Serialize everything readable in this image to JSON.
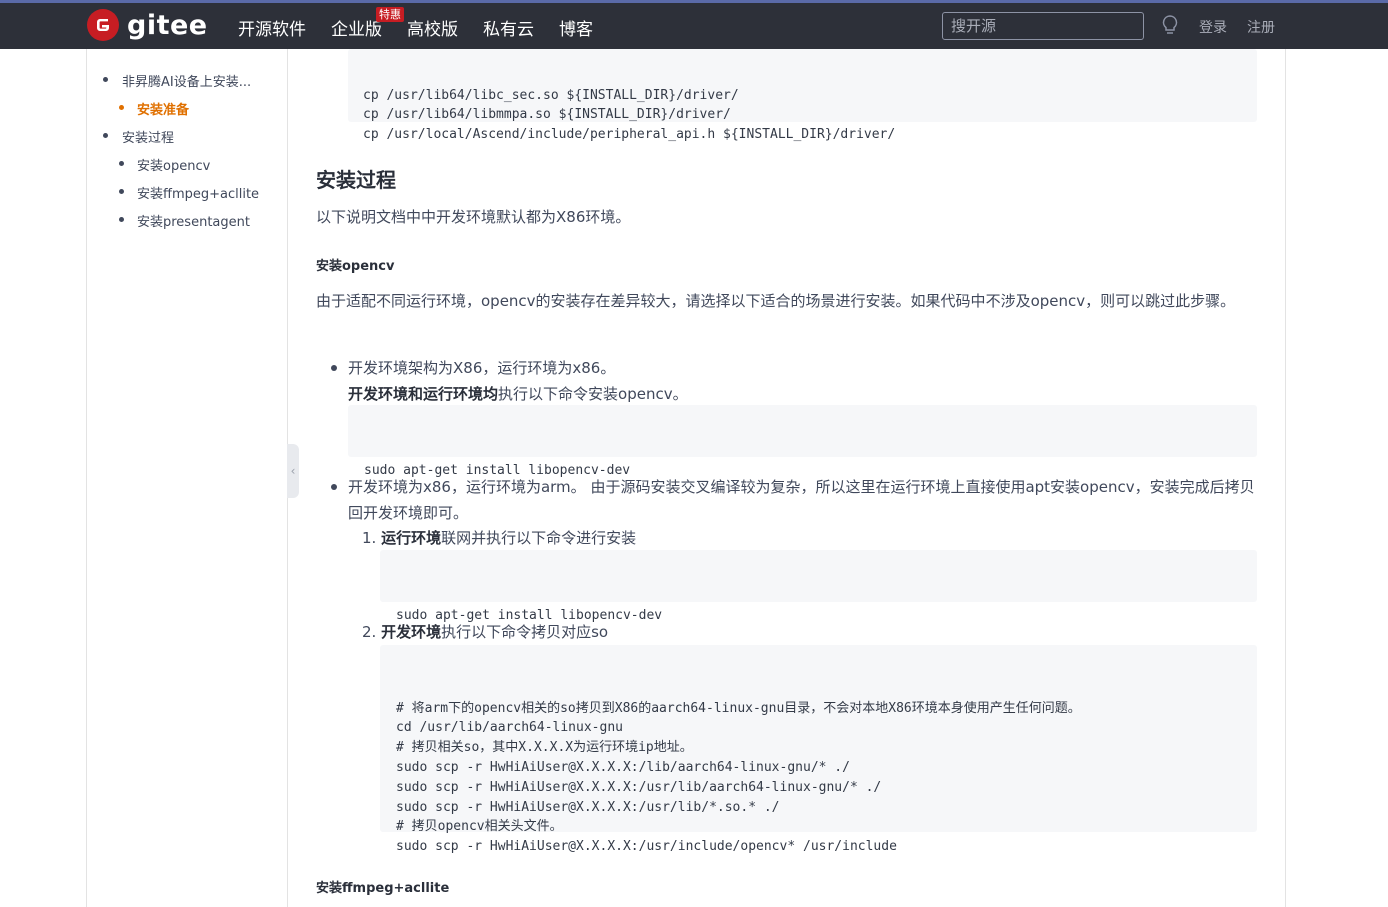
{
  "header": {
    "logo_text": "gitee",
    "nav": [
      "开源软件",
      "企业版",
      "高校版",
      "私有云",
      "博客"
    ],
    "badge": "特惠",
    "search_placeholder": "搜开源",
    "login": "登录",
    "register": "注册"
  },
  "toc": {
    "items": [
      "非昇腾AI设备上安装...",
      "安装准备",
      "安装过程",
      "安装opencv",
      "安装ffmpeg+acllite",
      "安装presentagent"
    ]
  },
  "content": {
    "code_top": "cp /usr/lib64/libc_sec.so ${INSTALL_DIR}/driver/\ncp /usr/lib64/libmmpa.so ${INSTALL_DIR}/driver/\ncp /usr/local/Ascend/include/peripheral_api.h ${INSTALL_DIR}/driver/",
    "section_title": "安装过程",
    "intro": "以下说明文档中中开发环境默认都为X86环境。",
    "opencv_title": "安装opencv",
    "opencv_desc": "由于适配不同运行环境，opencv的安装存在差异较大，请选择以下适合的场景进行安装。如果代码中不涉及opencv，则可以跳过此步骤。",
    "b1_line1": "开发环境架构为X86，运行环境为x86。",
    "b1_bold": "开发环境和运行环境均",
    "b1_rest": "执行以下命令安装opencv。",
    "code_b1": "sudo apt-get install libopencv-dev",
    "b2_text": "开发环境为x86，运行环境为arm。 由于源码安装交叉编译较为复杂，所以这里在运行环境上直接使用apt安装opencv，安装完成后拷贝回开发环境即可。",
    "step1_num": "1.",
    "step1_bold": "运行环境",
    "step1_rest": "联网并执行以下命令进行安装",
    "code_s1": "sudo apt-get install libopencv-dev",
    "step2_num": "2.",
    "step2_bold": "开发环境",
    "step2_rest": "执行以下命令拷贝对应so",
    "code_s2": "# 将arm下的opencv相关的so拷贝到X86的aarch64-linux-gnu目录，不会对本地X86环境本身使用产生任何问题。\ncd /usr/lib/aarch64-linux-gnu\n# 拷贝相关so，其中X.X.X.X为运行环境ip地址。\nsudo scp -r HwHiAiUser@X.X.X.X:/lib/aarch64-linux-gnu/* ./\nsudo scp -r HwHiAiUser@X.X.X.X:/usr/lib/aarch64-linux-gnu/* ./\nsudo scp -r HwHiAiUser@X.X.X.X:/usr/lib/*.so.* ./\n# 拷贝opencv相关头文件。\nsudo scp -r HwHiAiUser@X.X.X.X:/usr/include/opencv* /usr/include",
    "ffmpeg_title": "安装ffmpeg+acllite"
  },
  "colors": {
    "header_bg": "#2d3039",
    "brand": "#c71d23",
    "active_toc": "#e07000"
  }
}
